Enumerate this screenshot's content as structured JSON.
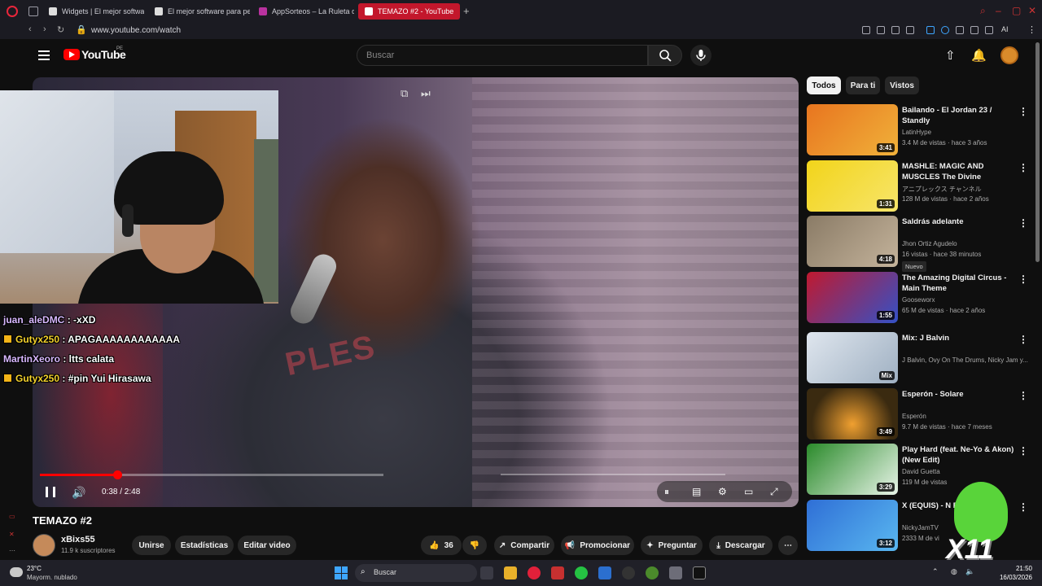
{
  "browser": {
    "tabs": [
      {
        "label": "Widgets | El mejor softwar",
        "active": false
      },
      {
        "label": "El mejor software para pe",
        "active": false
      },
      {
        "label": "AppSorteos – La Ruleta de",
        "active": false
      },
      {
        "label": "TEMAZO #2 - YouTube",
        "active": true
      }
    ],
    "url": "www.youtube.com/watch",
    "ai_label": "AI"
  },
  "header": {
    "brand": "YouTube",
    "region": "PE",
    "search_placeholder": "Buscar"
  },
  "player": {
    "time": "0:38 / 2:48",
    "progress": 0.226
  },
  "chat": [
    {
      "user": "juan_aleDMC",
      "message": " : -xXD",
      "badge": false,
      "gold": false
    },
    {
      "user": "Gutyx250",
      "message": " : APAGAAAAAAAAAAAA",
      "badge": true,
      "gold": true
    },
    {
      "user": "MartinXeoro",
      "message": " : ltts calata",
      "badge": false,
      "gold": false
    },
    {
      "user": "Gutyx250",
      "message": " : #pin Yui Hirasawa",
      "badge": true,
      "gold": true
    }
  ],
  "video": {
    "title": "TEMAZO #2",
    "channel": "xBixs55",
    "subscribers": "11.9 k suscriptores",
    "join": "Unirse",
    "stats": "Estadísticas",
    "edit": "Editar video",
    "likes": "36",
    "share": "Compartir",
    "promote": "Promocionar",
    "ask": "Preguntar",
    "download": "Descargar"
  },
  "chips": [
    "Todos",
    "Para ti",
    "Vistos"
  ],
  "recommendations": [
    {
      "title": "Bailando - El Jordan 23 / Standly",
      "channel": "LatinHype",
      "meta": "3.4 M de vistas · hace 3 años",
      "duration": "3:41",
      "thumb": "linear-gradient(135deg,#e8751f,#f0b13a)"
    },
    {
      "title": "MASHLE: MAGIC AND MUSCLES The Divine Visionar...",
      "channel": "アニプレックス チャンネル",
      "meta": "128 M de vistas · hace 2 años",
      "duration": "1:31",
      "thumb": "linear-gradient(135deg,#f2d41a,#f7e56a)"
    },
    {
      "title": "Saldrás adelante",
      "channel": "Jhon Ortiz Agudelo",
      "meta": "16 vistas · hace 38 minutos",
      "badge": "Nuevo",
      "duration": "4:18",
      "thumb": "linear-gradient(135deg,#8a7b66,#c4b39b)"
    },
    {
      "title": "The Amazing Digital Circus - Main Theme",
      "channel": "Gooseworx",
      "meta": "65 M de vistas · hace 2 años",
      "duration": "1:55",
      "thumb": "linear-gradient(135deg,#c0192f,#3451c6)"
    },
    {
      "title": "Mix: J Balvin",
      "channel": "J Balvin, Ovy On The Drums, Nicky Jam y...",
      "meta": "",
      "duration": "Mix",
      "thumb": "linear-gradient(135deg,#dfe6ee,#9fb0c2)"
    },
    {
      "title": "Esperón - Solare",
      "channel": "Esperón",
      "meta": "9.7 M de vistas · hace 7 meses",
      "duration": "3:49",
      "thumb": "radial-gradient(circle at 50% 70%,#f0a030,#3a2a10 70%)"
    },
    {
      "title": "Play Hard (feat. Ne-Yo & Akon) (New Edit)",
      "channel": "David Guetta",
      "meta": "119 M de vistas",
      "duration": "3:29",
      "thumb": "linear-gradient(135deg,#2a8a2a,#e8f4e8)"
    },
    {
      "title": "X (EQUIS) - N Balvin | Vide",
      "channel": "NickyJamTV",
      "meta": "2333 M de vi",
      "duration": "3:12",
      "thumb": "linear-gradient(135deg,#2f6fd6,#59b7f0)"
    }
  ],
  "overlay": {
    "mascot_text": "X11"
  },
  "taskbar": {
    "temp": "23°C",
    "weather": "Mayorm. nublado",
    "search": "Buscar",
    "time": "21:50",
    "date": "16/03/2026"
  },
  "colors": {
    "accent": "#ff0000",
    "tab_active": "#c3172c",
    "background": "#0f0f0f"
  }
}
